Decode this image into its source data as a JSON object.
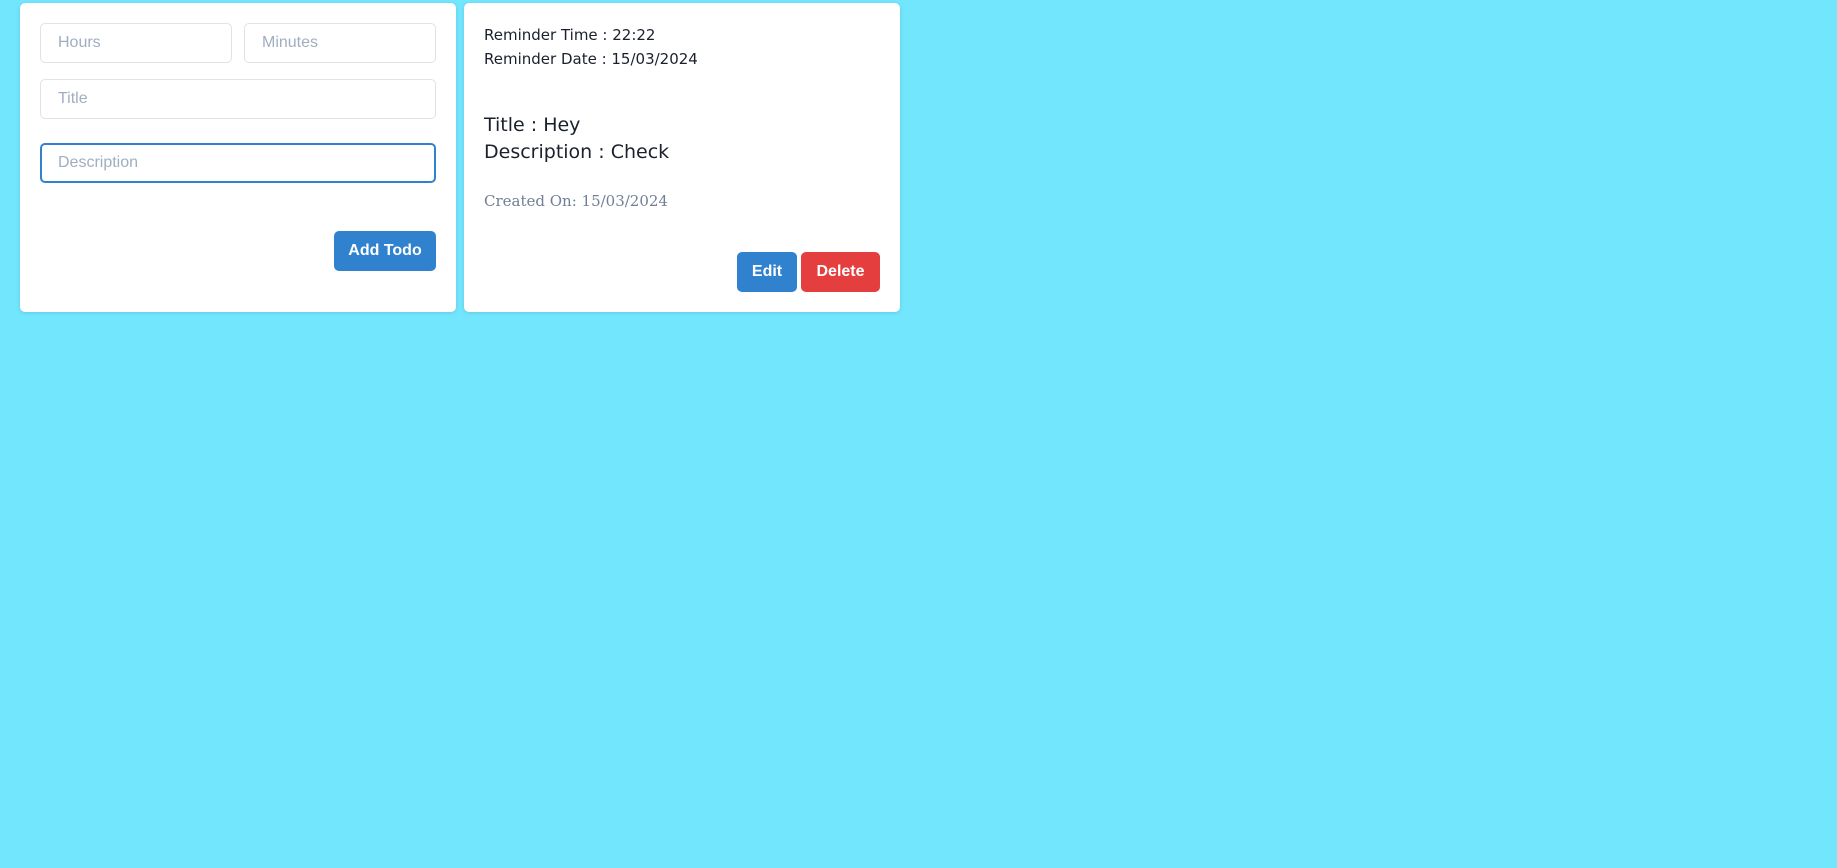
{
  "form": {
    "hours_placeholder": "Hours",
    "minutes_placeholder": "Minutes",
    "title_placeholder": "Title",
    "description_placeholder": "Description",
    "add_button_label": "Add Todo"
  },
  "todo": {
    "reminder_time_label": "Reminder Time : 22:22",
    "reminder_date_label": "Reminder Date : 15/03/2024",
    "title_label": "Title : Hey",
    "description_label": "Description : Check",
    "created_on_label": "Created On: 15/03/2024",
    "edit_button_label": "Edit",
    "delete_button_label": "Delete"
  },
  "colors": {
    "background": "#72e6fd",
    "primary": "#3182ce",
    "danger": "#e53e3e",
    "card": "#ffffff"
  }
}
